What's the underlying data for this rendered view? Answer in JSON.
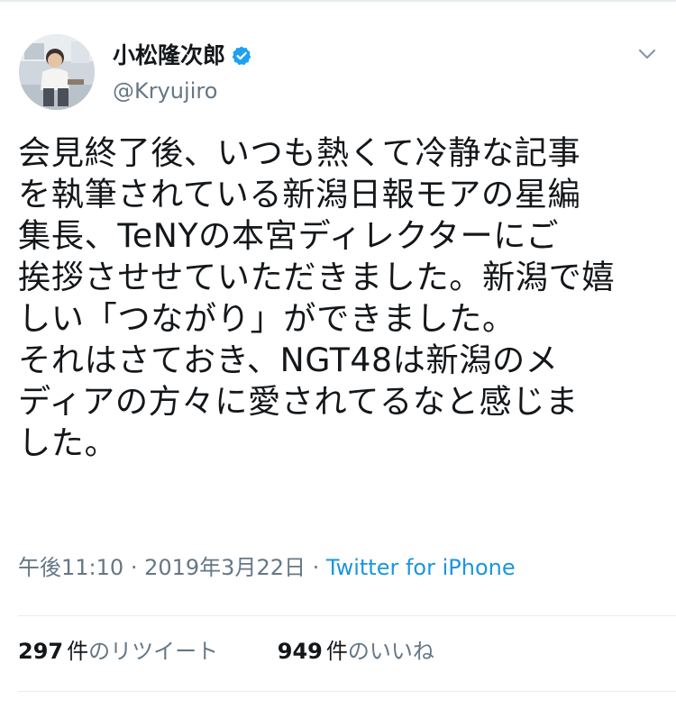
{
  "user": {
    "display_name": "小松隆次郎",
    "handle": "@Kryujiro",
    "verified_icon": "verified-badge-icon",
    "verified_color": "#1da1f2"
  },
  "tweet": {
    "text": "会見終了後、いつも熱くて冷静な記事\nを執筆されている新潟日報モアの星編\n集長、TeNYの本宮ディレクターにご\n挨拶させせていただきました。新潟で嬉\nしい「つながり」ができました。\nそれはさておき、NGT48は新潟のメ\nディアの方々に愛されてるなと感じま\nした。"
  },
  "meta": {
    "time": "午後11:10",
    "separator": "·",
    "date": "2019年3月22日",
    "source": "Twitter for iPhone"
  },
  "stats": {
    "retweets": {
      "count": "297",
      "unit": "件",
      "label": "のリツイート"
    },
    "likes": {
      "count": "949",
      "unit": "件",
      "label": "のいいね"
    }
  },
  "menu_icon": "chevron-down-icon",
  "colors": {
    "text": "#14171a",
    "secondary": "#657786",
    "link": "#1b95e0",
    "divider": "#e6ecf0"
  }
}
